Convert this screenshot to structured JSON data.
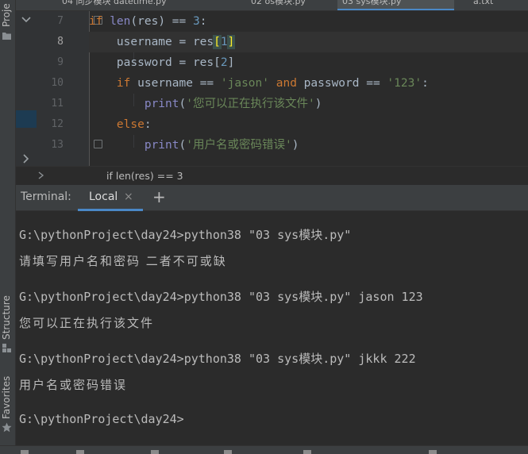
{
  "side": {
    "project_label": "Proje",
    "structure_label": "Structure",
    "favorites_label": "Favorites"
  },
  "tabs": [
    {
      "label": "04 同步模块 datetime.py"
    },
    {
      "label": "02 os模块.py"
    },
    {
      "label": "03 sys模块.py"
    },
    {
      "label": "a.txt"
    }
  ],
  "editor": {
    "line_numbers": [
      "7",
      "8",
      "9",
      "10",
      "11",
      "12",
      "13"
    ],
    "lines": [
      {
        "indent": "",
        "parts": [
          {
            "t": "if ",
            "c": "kw"
          },
          {
            "t": "len",
            "c": "bi"
          },
          {
            "t": "(res) == ",
            "c": ""
          },
          {
            "t": "3",
            "c": "num"
          },
          {
            "t": ":",
            "c": ""
          }
        ]
      },
      {
        "indent": "    ",
        "parts": [
          {
            "t": "username = res",
            "c": ""
          },
          {
            "t": "[",
            "c": "brk"
          },
          {
            "t": "1",
            "c": "num"
          },
          {
            "t": "]",
            "c": "brk"
          }
        ]
      },
      {
        "indent": "    ",
        "parts": [
          {
            "t": "password = res[",
            "c": ""
          },
          {
            "t": "2",
            "c": "num"
          },
          {
            "t": "]",
            "c": ""
          }
        ]
      },
      {
        "indent": "    ",
        "parts": [
          {
            "t": "if ",
            "c": "kw"
          },
          {
            "t": "username == ",
            "c": ""
          },
          {
            "t": "'jason'",
            "c": "str"
          },
          {
            "t": " and ",
            "c": "kw"
          },
          {
            "t": "password == ",
            "c": ""
          },
          {
            "t": "'123'",
            "c": "str"
          },
          {
            "t": ":",
            "c": ""
          }
        ]
      },
      {
        "indent": "        ",
        "parts": [
          {
            "t": "print",
            "c": "bi"
          },
          {
            "t": "(",
            "c": ""
          },
          {
            "t": "'您可以正在执行该文件'",
            "c": "str"
          },
          {
            "t": ")",
            "c": ""
          }
        ]
      },
      {
        "indent": "    ",
        "parts": [
          {
            "t": "else",
            "c": "kw"
          },
          {
            "t": ":",
            "c": ""
          }
        ]
      },
      {
        "indent": "        ",
        "parts": [
          {
            "t": "print",
            "c": "bi"
          },
          {
            "t": "(",
            "c": ""
          },
          {
            "t": "'用户名或密码错误'",
            "c": "str"
          },
          {
            "t": ")",
            "c": ""
          }
        ]
      }
    ]
  },
  "breadcrumb": {
    "text": "if len(res) == 3"
  },
  "terminal": {
    "title": "Terminal:",
    "tab_label": "Local",
    "close_glyph": "×",
    "add_glyph": "+",
    "lines": [
      {
        "text": "G:\\pythonProject\\day24>python38 \"03 sys模块.py\"",
        "zh": false
      },
      {
        "text": "请填写用户名和密码 二者不可或缺",
        "zh": true
      },
      {
        "text": "",
        "zh": false
      },
      {
        "text": "G:\\pythonProject\\day24>python38 \"03 sys模块.py\" jason 123",
        "zh": false
      },
      {
        "text": "您可以正在执行该文件",
        "zh": true
      },
      {
        "text": "",
        "zh": false
      },
      {
        "text": "G:\\pythonProject\\day24>python38 \"03 sys模块.py\" jkkk 222",
        "zh": false
      },
      {
        "text": "用户名或密码错误",
        "zh": true
      },
      {
        "text": "",
        "zh": false
      },
      {
        "text": "G:\\pythonProject\\day24>",
        "zh": false
      }
    ]
  },
  "colors": {
    "accent": "#4a88c7",
    "keyword": "#cc7832",
    "string": "#6a8759",
    "number": "#6897bb"
  }
}
